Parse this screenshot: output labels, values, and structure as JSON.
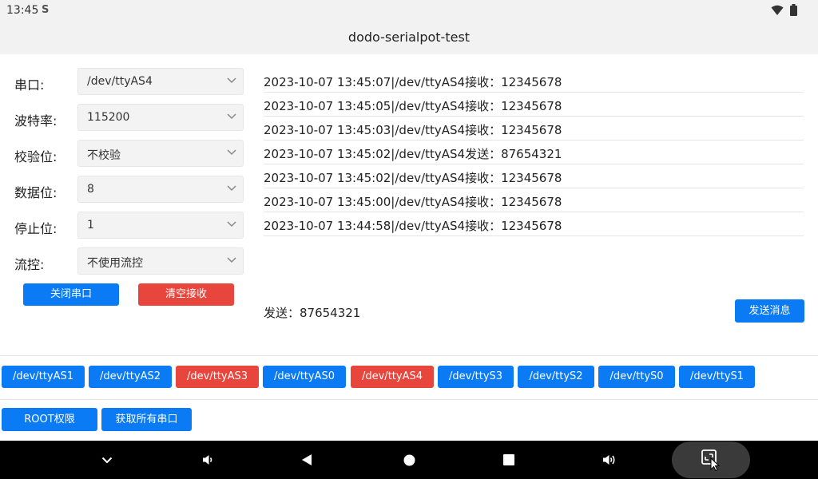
{
  "status_bar": {
    "time": "13:45",
    "indicator": "S",
    "icons": [
      "wifi-icon",
      "battery-icon"
    ]
  },
  "app": {
    "title": "dodo-serialpot-test"
  },
  "settings": [
    {
      "label": "串口:",
      "value": "/dev/ttyAS4"
    },
    {
      "label": "波特率:",
      "value": "115200"
    },
    {
      "label": "校验位:",
      "value": "不校验"
    },
    {
      "label": "数据位:",
      "value": "8"
    },
    {
      "label": "停止位:",
      "value": "1"
    },
    {
      "label": "流控:",
      "value": "不使用流控"
    }
  ],
  "actions": {
    "close_port": "关闭串口",
    "clear_receive": "清空接收"
  },
  "log": [
    "2023-10-07 13:45:07|/dev/ttyAS4接收：12345678",
    "2023-10-07 13:45:05|/dev/ttyAS4接收：12345678",
    "2023-10-07 13:45:03|/dev/ttyAS4接收：12345678",
    "2023-10-07 13:45:02|/dev/ttyAS4发送：87654321",
    "2023-10-07 13:45:02|/dev/ttyAS4接收：12345678",
    "2023-10-07 13:45:00|/dev/ttyAS4接收：12345678",
    "2023-10-07 13:44:58|/dev/ttyAS4接收：12345678"
  ],
  "send": {
    "text": "发送：87654321",
    "button": "发送消息"
  },
  "ports": [
    {
      "label": "/dev/ttyAS1",
      "active": false
    },
    {
      "label": "/dev/ttyAS2",
      "active": false
    },
    {
      "label": "/dev/ttyAS3",
      "active": true
    },
    {
      "label": "/dev/ttyAS0",
      "active": false
    },
    {
      "label": "/dev/ttyAS4",
      "active": true
    },
    {
      "label": "/dev/ttyS3",
      "active": false
    },
    {
      "label": "/dev/ttyS2",
      "active": false
    },
    {
      "label": "/dev/ttyS0",
      "active": false
    },
    {
      "label": "/dev/ttyS1",
      "active": false
    }
  ],
  "bottom_actions": {
    "root": "ROOT权限",
    "get_ports": "获取所有串口"
  },
  "colors": {
    "primary": "#0a7bf5",
    "danger": "#e8453c",
    "navbar": "#000000"
  },
  "navbar": [
    "chevron-down-icon",
    "volume-down-icon",
    "back-icon",
    "home-icon",
    "recents-icon",
    "volume-up-icon",
    "screenshot-icon"
  ]
}
